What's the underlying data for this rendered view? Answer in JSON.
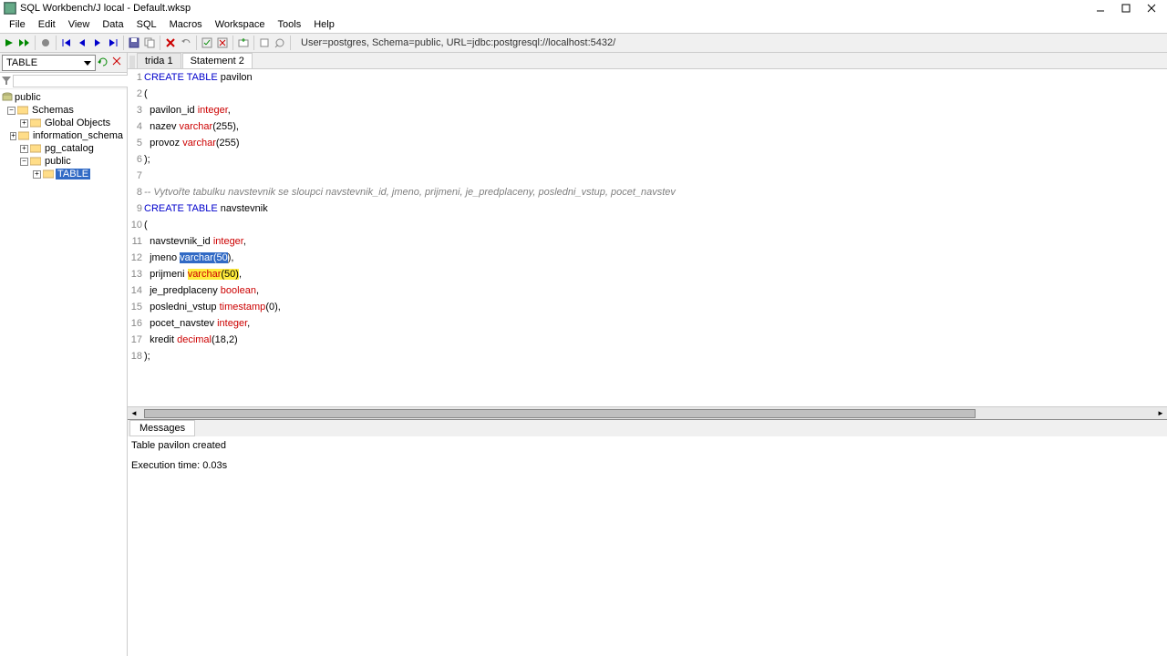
{
  "window": {
    "title": "SQL Workbench/J local - Default.wksp"
  },
  "menu": [
    "File",
    "Edit",
    "View",
    "Data",
    "SQL",
    "Macros",
    "Workspace",
    "Tools",
    "Help"
  ],
  "toolbar_status": "User=postgres, Schema=public, URL=jdbc:postgresql://localhost:5432/",
  "sidebar": {
    "combo": "TABLE",
    "root": "public",
    "nodes": [
      {
        "label": "Schemas",
        "indent": 0,
        "expanded": true
      },
      {
        "label": "Global Objects",
        "indent": 1,
        "expanded": false
      },
      {
        "label": "information_schema",
        "indent": 1,
        "expanded": false
      },
      {
        "label": "pg_catalog",
        "indent": 1,
        "expanded": false
      },
      {
        "label": "public",
        "indent": 1,
        "expanded": true
      },
      {
        "label": "TABLE",
        "indent": 2,
        "expanded": false,
        "selected": true
      }
    ]
  },
  "tabs": [
    {
      "label": "trida 1",
      "active": false
    },
    {
      "label": "Statement 2",
      "active": true
    }
  ],
  "code_lines": [
    {
      "n": 1,
      "tokens": [
        {
          "t": "CREATE TABLE",
          "c": "kw"
        },
        {
          "t": " pavilon",
          "c": ""
        }
      ]
    },
    {
      "n": 2,
      "tokens": [
        {
          "t": "(",
          "c": ""
        }
      ]
    },
    {
      "n": 3,
      "tokens": [
        {
          "t": "  pavilon_id ",
          "c": ""
        },
        {
          "t": "integer",
          "c": "type"
        },
        {
          "t": ",",
          "c": ""
        }
      ]
    },
    {
      "n": 4,
      "tokens": [
        {
          "t": "  nazev ",
          "c": ""
        },
        {
          "t": "varchar",
          "c": "type"
        },
        {
          "t": "(255),",
          "c": ""
        }
      ]
    },
    {
      "n": 5,
      "tokens": [
        {
          "t": "  provoz ",
          "c": ""
        },
        {
          "t": "varchar",
          "c": "type"
        },
        {
          "t": "(255)",
          "c": ""
        }
      ]
    },
    {
      "n": 6,
      "tokens": [
        {
          "t": ");",
          "c": ""
        }
      ]
    },
    {
      "n": 7,
      "tokens": [
        {
          "t": "",
          "c": ""
        }
      ]
    },
    {
      "n": 8,
      "tokens": [
        {
          "t": "-- Vytvořte tabulku navstevnik se sloupci navstevnik_id, jmeno, prijmeni, je_predplaceny, posledni_vstup, pocet_navstev",
          "c": "comment"
        }
      ]
    },
    {
      "n": 9,
      "tokens": [
        {
          "t": "CREATE TABLE",
          "c": "kw"
        },
        {
          "t": " navstevnik",
          "c": ""
        }
      ]
    },
    {
      "n": 10,
      "tokens": [
        {
          "t": "(",
          "c": ""
        }
      ]
    },
    {
      "n": 11,
      "tokens": [
        {
          "t": "  navstevnik_id ",
          "c": ""
        },
        {
          "t": "integer",
          "c": "type"
        },
        {
          "t": ",",
          "c": ""
        }
      ]
    },
    {
      "n": 12,
      "tokens": [
        {
          "t": "  jmeno ",
          "c": ""
        },
        {
          "t": "varchar(50",
          "c": "type selected"
        },
        {
          "t": ")",
          "c": ""
        },
        {
          "t": ",",
          "c": ""
        }
      ]
    },
    {
      "n": 13,
      "tokens": [
        {
          "t": "  prijmeni ",
          "c": ""
        },
        {
          "t": "varchar",
          "c": "type warn"
        },
        {
          "t": "(50)",
          "c": "warn"
        },
        {
          "t": ",",
          "c": ""
        }
      ]
    },
    {
      "n": 14,
      "tokens": [
        {
          "t": "  je_predplaceny ",
          "c": ""
        },
        {
          "t": "boolean",
          "c": "type"
        },
        {
          "t": ",",
          "c": ""
        }
      ]
    },
    {
      "n": 15,
      "tokens": [
        {
          "t": "  posledni_vstup ",
          "c": ""
        },
        {
          "t": "timestamp",
          "c": "type"
        },
        {
          "t": "(0),",
          "c": ""
        }
      ]
    },
    {
      "n": 16,
      "tokens": [
        {
          "t": "  pocet_navstev ",
          "c": ""
        },
        {
          "t": "integer",
          "c": "type"
        },
        {
          "t": ",",
          "c": ""
        }
      ]
    },
    {
      "n": 17,
      "tokens": [
        {
          "t": "  kredit ",
          "c": ""
        },
        {
          "t": "decimal",
          "c": "type"
        },
        {
          "t": "(18,2)",
          "c": ""
        }
      ]
    },
    {
      "n": 18,
      "tokens": [
        {
          "t": ");",
          "c": ""
        }
      ]
    }
  ],
  "messages": {
    "tab": "Messages",
    "line1": "Table pavilon created",
    "line2": "Execution time: 0.03s"
  }
}
